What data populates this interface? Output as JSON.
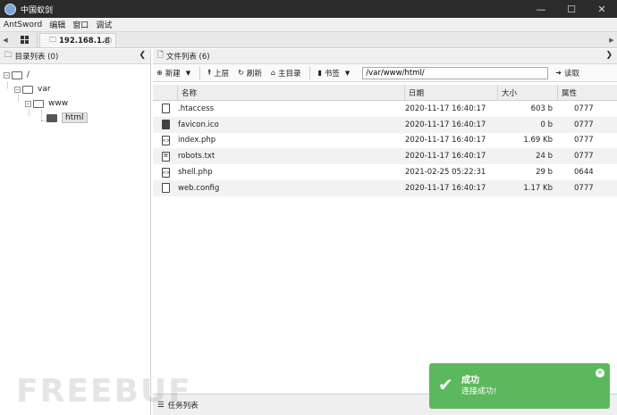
{
  "window": {
    "title": "中国蚁剑",
    "controls": [
      "minimize-icon",
      "maximize-icon",
      "close-icon"
    ]
  },
  "menu": {
    "items": [
      "AntSword",
      "编辑",
      "窗口",
      "调试"
    ]
  },
  "tabs": {
    "host_label": "192.168.1.8"
  },
  "left_panel": {
    "title": "目录列表 (0)",
    "tree": [
      {
        "label": "/"
      },
      {
        "label": "var"
      },
      {
        "label": "www"
      },
      {
        "label": "html",
        "selected": true
      }
    ]
  },
  "right_panel": {
    "title": "文件列表 (6)",
    "toolbar": {
      "new_label": "新建",
      "up_label": "上层",
      "refresh_label": "刷新",
      "home_label": "主目录",
      "bookmark_label": "书签",
      "path_value": "/var/www/html/",
      "read_label": "读取"
    },
    "columns": {
      "name": "名称",
      "date": "日期",
      "size": "大小",
      "attr": "属性"
    },
    "files": [
      {
        "name": ".htaccess",
        "date": "2020-11-17 16:40:17",
        "size": "603 b",
        "attr": "0777",
        "icon": "file-icon"
      },
      {
        "name": "favicon.ico",
        "date": "2020-11-17 16:40:17",
        "size": "0 b",
        "attr": "0777",
        "icon": "image-file-icon"
      },
      {
        "name": "index.php",
        "date": "2020-11-17 16:40:17",
        "size": "1.69 Kb",
        "attr": "0777",
        "icon": "code-file-icon"
      },
      {
        "name": "robots.txt",
        "date": "2020-11-17 16:40:17",
        "size": "24 b",
        "attr": "0777",
        "icon": "text-file-icon"
      },
      {
        "name": "shell.php",
        "date": "2021-02-25 05:22:31",
        "size": "29 b",
        "attr": "0644",
        "icon": "code-file-icon"
      },
      {
        "name": "web.config",
        "date": "2020-11-17 16:40:17",
        "size": "1.17 Kb",
        "attr": "0777",
        "icon": "file-icon"
      }
    ]
  },
  "task_panel": {
    "title": "任务列表"
  },
  "toast": {
    "title": "成功",
    "message": "连接成功!"
  },
  "watermark": "FREEBUF",
  "colors": {
    "titlebar": "#2b2b2b",
    "toast_success": "#5cb85c"
  }
}
